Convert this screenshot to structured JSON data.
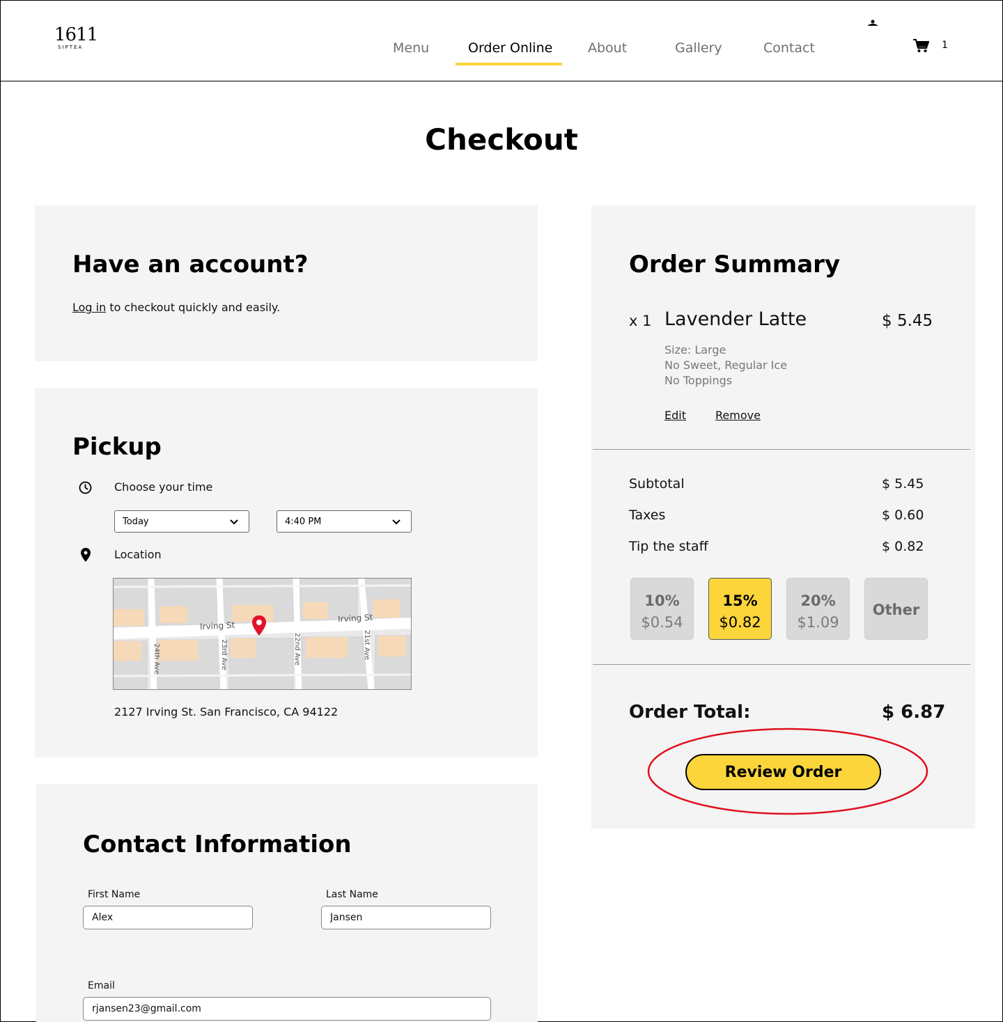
{
  "header": {
    "logo_main": "1611",
    "logo_sub": "SIPTEA",
    "nav": [
      {
        "label": "Menu"
      },
      {
        "label": "Order Online"
      },
      {
        "label": "About"
      },
      {
        "label": "Gallery"
      },
      {
        "label": "Contact"
      }
    ],
    "active_nav": "Order Online",
    "cart_count": "1",
    "accent_color": "#fcd53a"
  },
  "page_title": "Checkout",
  "account": {
    "heading": "Have an account?",
    "login_link": "Log in",
    "login_text": " to checkout quickly and easily."
  },
  "pickup": {
    "heading": "Pickup",
    "time_label": "Choose your time",
    "day_value": "Today",
    "time_value": "4:40 PM",
    "location_label": "Location",
    "map_streets": {
      "irving_left": "Irving St",
      "irving_right": "Irving St",
      "ave_24": "24th Ave",
      "ave_23": "23rd Ave",
      "ave_22": "22nd Ave",
      "ave_21": "21st Ave"
    },
    "address": "2127 Irving St. San Francisco, CA 94122"
  },
  "contact": {
    "heading": "Contact Information",
    "first_name_label": "First Name",
    "first_name_value": "Alex",
    "last_name_label": "Last Name",
    "last_name_value": "Jansen",
    "email_label": "Email",
    "email_value": "rjansen23@gmail.com"
  },
  "summary": {
    "heading": "Order Summary",
    "item": {
      "qty": "x 1",
      "name": "Lavender Latte",
      "price": "$ 5.45",
      "options": [
        "Size: Large",
        "No Sweet, Regular Ice",
        "No Toppings"
      ],
      "edit_label": "Edit",
      "remove_label": "Remove"
    },
    "subtotal_label": "Subtotal",
    "subtotal_value": "$ 5.45",
    "taxes_label": "Taxes",
    "taxes_value": "$ 0.60",
    "tip_label": "Tip the staff",
    "tip_value": "$ 0.82",
    "tips": [
      {
        "pct": "10%",
        "amount": "$0.54",
        "selected": false
      },
      {
        "pct": "15%",
        "amount": "$0.82",
        "selected": true
      },
      {
        "pct": "20%",
        "amount": "$1.09",
        "selected": false
      },
      {
        "pct": "Other",
        "selected": false
      }
    ],
    "total_label": "Order Total:",
    "total_value": "$ 6.87",
    "review_button": "Review Order"
  }
}
